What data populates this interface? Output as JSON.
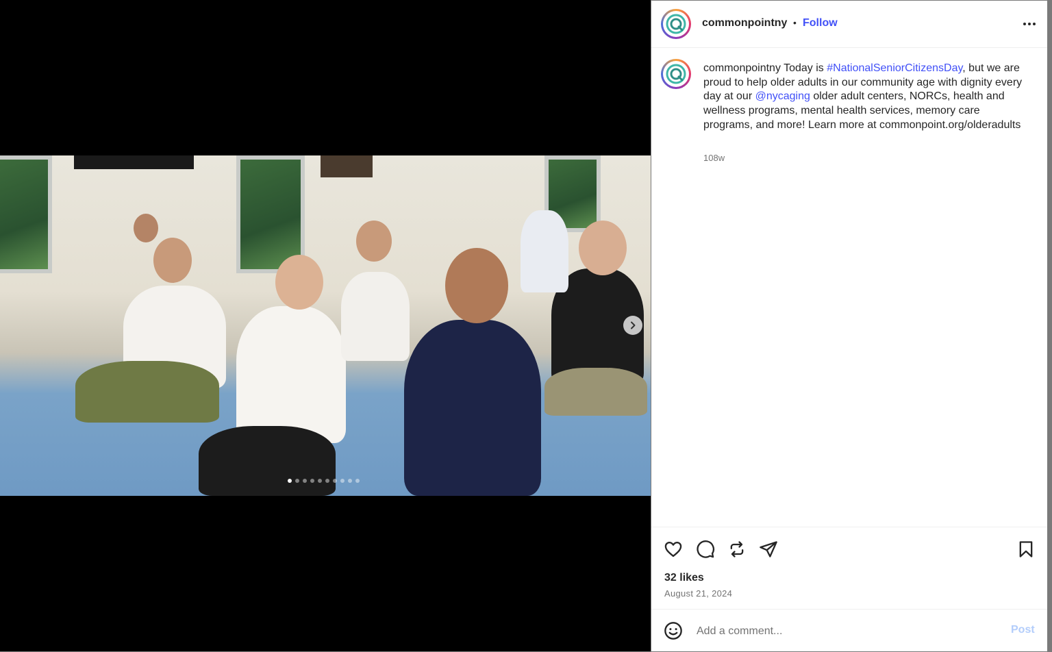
{
  "post": {
    "username": "commonpointny",
    "separator": "•",
    "follow_label": "Follow",
    "more_icon": "more-horizontal-icon",
    "caption": {
      "username": "commonpointny",
      "text_1": " Today is ",
      "hashtag": "#NationalSeniorCitizensDay",
      "text_2": ", but we are proud to help older adults in our community age with dignity every day at our ",
      "mention": "@nycaging",
      "text_3": " older adult centers, NORCs, health and wellness programs, mental health services, memory care programs, and more! Learn more at commonpoint.org/olderadults"
    },
    "age": "108w",
    "likes": "32 likes",
    "date": "August 21, 2024",
    "comment_placeholder": "Add a comment...",
    "post_label": "Post"
  },
  "carousel": {
    "total_slides": 10,
    "active_index": 0
  },
  "colors": {
    "link": "#4150f7",
    "post_disabled": "#b3cdfb",
    "muted": "#737373"
  }
}
